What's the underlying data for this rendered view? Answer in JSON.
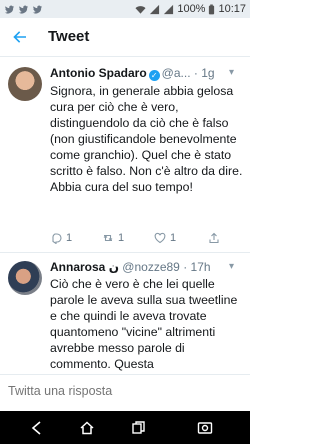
{
  "status_bar": {
    "battery": "100%",
    "time": "10:17"
  },
  "header": {
    "title": "Tweet"
  },
  "tweets": [
    {
      "name": "Antonio Spadaro",
      "handle": "@a...",
      "time": "1g",
      "text": "Signora, in generale abbia gelosa cura per ciò che è vero, distinguendolo da ciò che è falso (non giustificandole benevolmente come granchio). Quel che è stato scritto è falso. Non c'è altro da dire. Abbia cura del suo tempo!",
      "replies": "1",
      "retweets": "1",
      "likes": "1"
    },
    {
      "name": "Annarosa",
      "name_suffix": "ن",
      "handle": "@nozze89",
      "time": "17h",
      "text": "Ciò che è vero è che lei quelle parole le aveva sulla sua tweetline  e che quindi le aveva trovate quantomeno \"vicine\" altrimenti avrebbe messo parole di commento. Questa"
    }
  ],
  "reply": {
    "placeholder": "Twitta una risposta"
  },
  "colors": {
    "accent": "#1da1f2",
    "secondary_text": "#657786"
  }
}
